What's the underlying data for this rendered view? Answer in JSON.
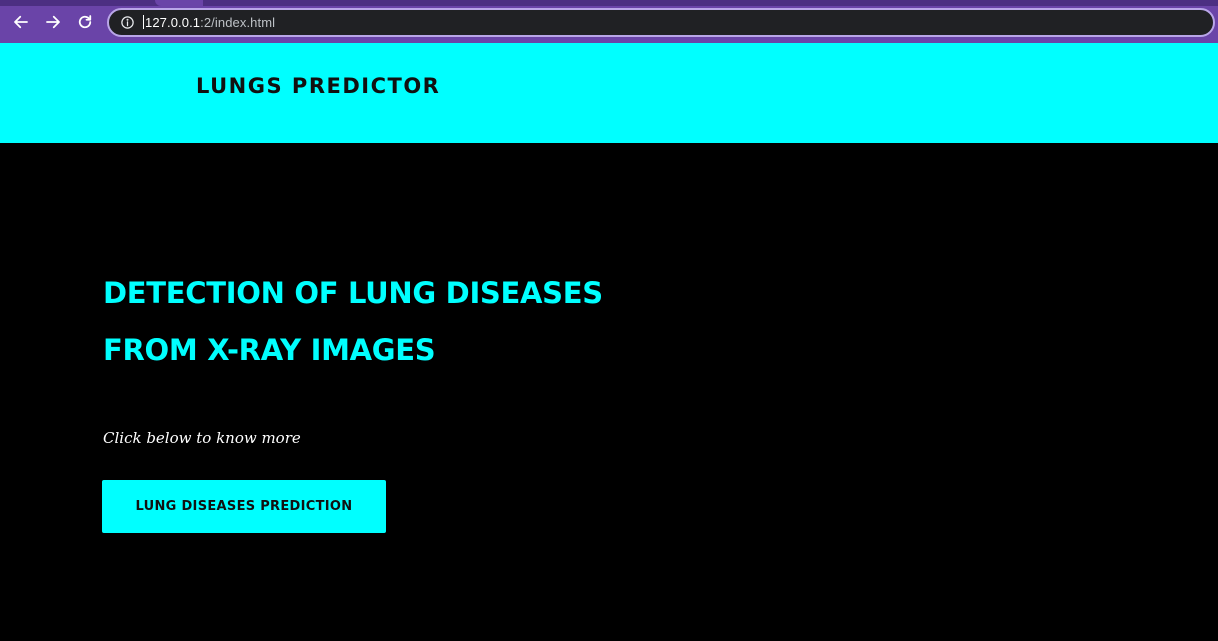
{
  "browser": {
    "url_host": "127.0.0.1",
    "url_path": ":2/index.html",
    "icons": {
      "back": "back-arrow-icon",
      "forward": "forward-arrow-icon",
      "reload": "reload-icon",
      "site_info": "info-icon"
    }
  },
  "header": {
    "brand": "LUNGS PREDICTOR"
  },
  "hero": {
    "title_line1": "DETECTION OF LUNG DISEASES",
    "title_line2": "FROM X-RAY IMAGES",
    "subtitle": "Click below to know more",
    "cta_label": "LUNG DISEASES PREDICTION"
  },
  "colors": {
    "accent": "#00ffff",
    "background": "#000000",
    "browser_frame": "#6a44a8",
    "omnibox": "#202124"
  }
}
